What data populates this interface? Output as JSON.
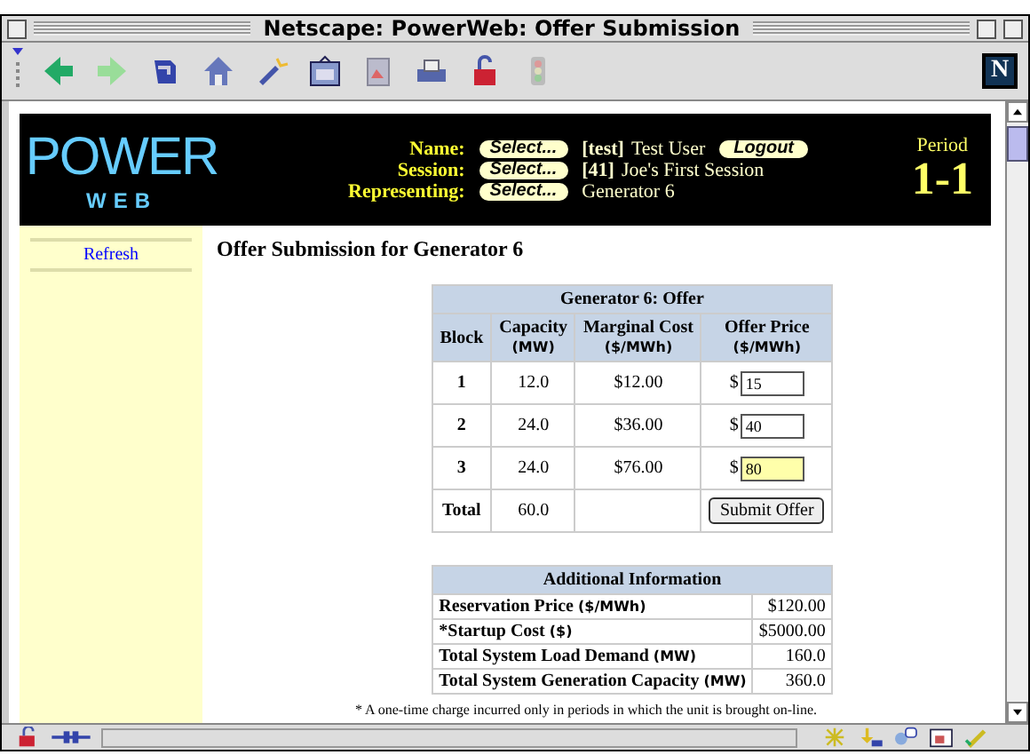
{
  "window": {
    "title": "Netscape: PowerWeb: Offer Submission"
  },
  "browser_logo": "N",
  "header": {
    "logo_top": "POWER",
    "logo_bottom": "WEB",
    "rows": [
      {
        "label": "Name:",
        "select": "Select...",
        "tag": "[test]",
        "value": "Test User",
        "logout": "Logout"
      },
      {
        "label": "Session:",
        "select": "Select...",
        "tag": "[41]",
        "value": "Joe's First Session"
      },
      {
        "label": "Representing:",
        "select": "Select...",
        "value": "Generator 6"
      }
    ],
    "period_label": "Period",
    "period": "1-1"
  },
  "sidebar": {
    "links": [
      "Refresh"
    ]
  },
  "page_title": "Offer Submission for Generator 6",
  "offer_table": {
    "title": "Generator 6: Offer",
    "columns": [
      {
        "name": "Block"
      },
      {
        "name": "Capacity",
        "unit": "(MW)"
      },
      {
        "name": "Marginal Cost",
        "unit": "($/MWh)"
      },
      {
        "name": "Offer Price",
        "unit": "($/MWh)"
      }
    ],
    "rows": [
      {
        "block": "1",
        "capacity": "12.0",
        "cost": "$12.00",
        "currency": "$",
        "price": "15",
        "highlighted": false
      },
      {
        "block": "2",
        "capacity": "24.0",
        "cost": "$36.00",
        "currency": "$",
        "price": "40",
        "highlighted": false
      },
      {
        "block": "3",
        "capacity": "24.0",
        "cost": "$76.00",
        "currency": "$",
        "price": "80",
        "highlighted": true
      }
    ],
    "total_label": "Total",
    "total_capacity": "60.0",
    "submit": "Submit Offer"
  },
  "info_table": {
    "title": "Additional Information",
    "rows": [
      {
        "label": "Reservation Price",
        "unit": "($/MWh)",
        "value": "$120.00"
      },
      {
        "label": "*Startup Cost",
        "unit": "($)",
        "value": "$5000.00"
      },
      {
        "label": "Total System Load Demand",
        "unit": "(MW)",
        "value": "160.0"
      },
      {
        "label": "Total System Generation Capacity",
        "unit": "(MW)",
        "value": "360.0"
      }
    ]
  },
  "footnote": "* A one-time charge incurred only in periods in which the unit is brought on-line."
}
